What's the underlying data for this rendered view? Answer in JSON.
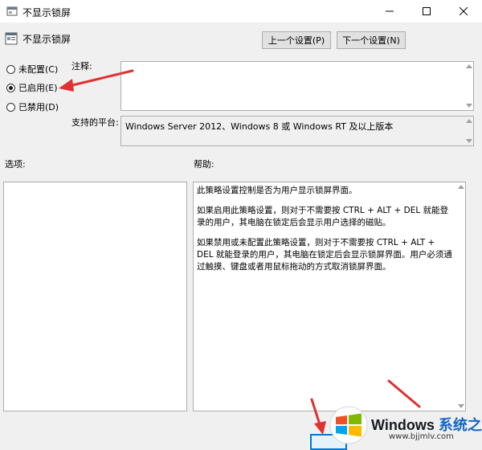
{
  "window": {
    "title": "不显示锁屏",
    "minimize_label": "Minimize",
    "maximize_label": "Maximize",
    "close_label": "Close"
  },
  "policy": {
    "name": "不显示锁屏"
  },
  "nav": {
    "prev_label": "上一个设置(P)",
    "next_label": "下一个设置(N)"
  },
  "state": {
    "options": [
      {
        "label": "未配置(C)",
        "checked": false
      },
      {
        "label": "已启用(E)",
        "checked": true
      },
      {
        "label": "已禁用(D)",
        "checked": false
      }
    ]
  },
  "comment": {
    "label": "注释:",
    "value": ""
  },
  "platform": {
    "label": "支持的平台:",
    "value": "Windows Server 2012、Windows 8 或 Windows RT 及以上版本"
  },
  "options_pane": {
    "label": "选项:"
  },
  "help_pane": {
    "label": "帮助:",
    "paragraphs": [
      "此策略设置控制是否为用户显示锁屏界面。",
      "如果启用此策略设置，则对于不需要按 CTRL + ALT + DEL 就能登录的用户，其电脑在锁定后会显示用户选择的磁贴。",
      "如果禁用或未配置此策略设置，则对于不需要按 CTRL + ALT + DEL 就能登录的用户，其电脑在锁定后会显示锁屏界面。用户必须通过触摸、键盘或者用鼠标拖动的方式取消锁屏界面。"
    ]
  },
  "watermark": {
    "brand": "Windows",
    "brand_cn": "系统之家",
    "url": "www.bjjmlv.com"
  },
  "colors": {
    "annotation_arrow": "#e03030",
    "accent": "#0078d7"
  }
}
